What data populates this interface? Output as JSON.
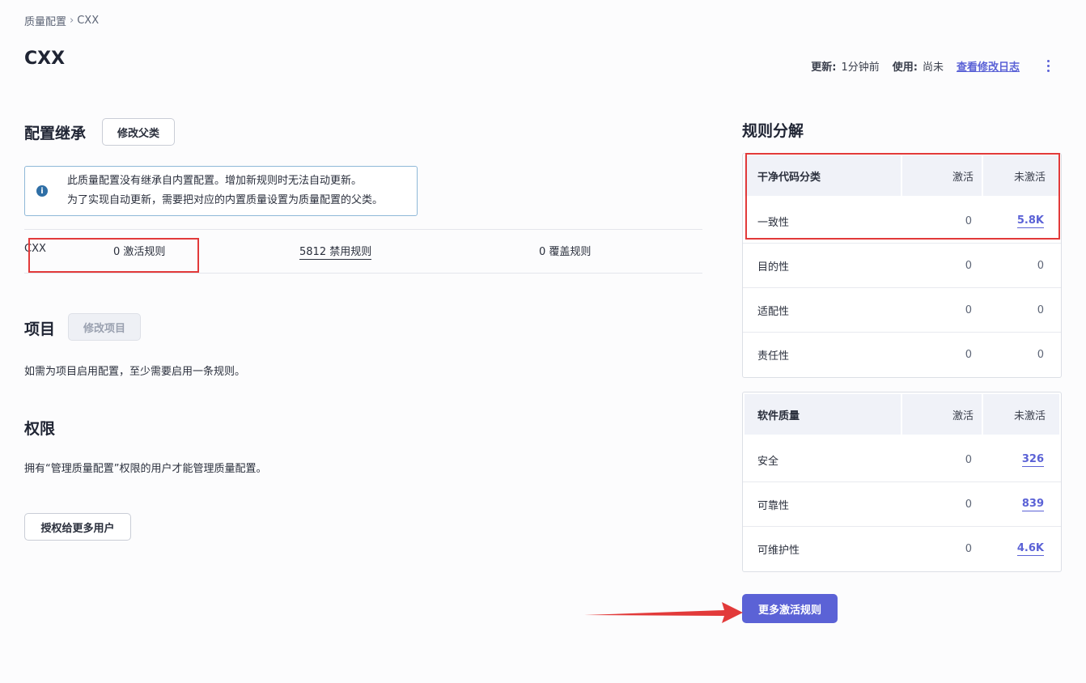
{
  "breadcrumb": {
    "parent": "质量配置",
    "separator": "›",
    "current": "CXX"
  },
  "page": {
    "title": "CXX"
  },
  "meta": {
    "updated_label": "更新:",
    "updated_value": "1分钟前",
    "used_label": "使用:",
    "used_value": "尚未",
    "changelog_link": "查看修改日志"
  },
  "inheritance": {
    "title": "配置继承",
    "change_parent_button": "修改父类",
    "info_line1": "此质量配置没有继承自内置配置。增加新规则时无法自动更新。",
    "info_line2": "为了实现自动更新，需要把对应的内置质量设置为质量配置的父类。",
    "row": {
      "name": "CXX",
      "active_rules": "0 激活规则",
      "inactive_rules": "5812 禁用规则",
      "overridden_rules": "0 覆盖规则"
    }
  },
  "projects": {
    "title": "项目",
    "change_projects_button": "修改项目",
    "description": "如需为项目启用配置，至少需要启用一条规则。"
  },
  "permissions": {
    "title": "权限",
    "description": "拥有“管理质量配置”权限的用户才能管理质量配置。",
    "grant_button": "授权给更多用户"
  },
  "rules_breakdown": {
    "title": "规则分解",
    "clean_code": {
      "header": {
        "category": "干净代码分类",
        "active": "激活",
        "inactive": "未激活"
      },
      "rows": [
        {
          "label": "一致性",
          "active": "0",
          "inactive": "5.8K"
        },
        {
          "label": "目的性",
          "active": "0",
          "inactive": "0"
        },
        {
          "label": "适配性",
          "active": "0",
          "inactive": "0"
        },
        {
          "label": "责任性",
          "active": "0",
          "inactive": "0"
        }
      ]
    },
    "software_quality": {
      "header": {
        "category": "软件质量",
        "active": "激活",
        "inactive": "未激活"
      },
      "rows": [
        {
          "label": "安全",
          "active": "0",
          "inactive": "326"
        },
        {
          "label": "可靠性",
          "active": "0",
          "inactive": "839"
        },
        {
          "label": "可维护性",
          "active": "0",
          "inactive": "4.6K"
        }
      ]
    },
    "activate_more_button": "更多激活规则"
  },
  "colors": {
    "accent": "#5b62d6",
    "annotation_red": "#e23a3a",
    "info_border": "#8fb8d8"
  },
  "icons": [
    "info-icon",
    "kebab-menu-icon",
    "annotation-arrow"
  ]
}
